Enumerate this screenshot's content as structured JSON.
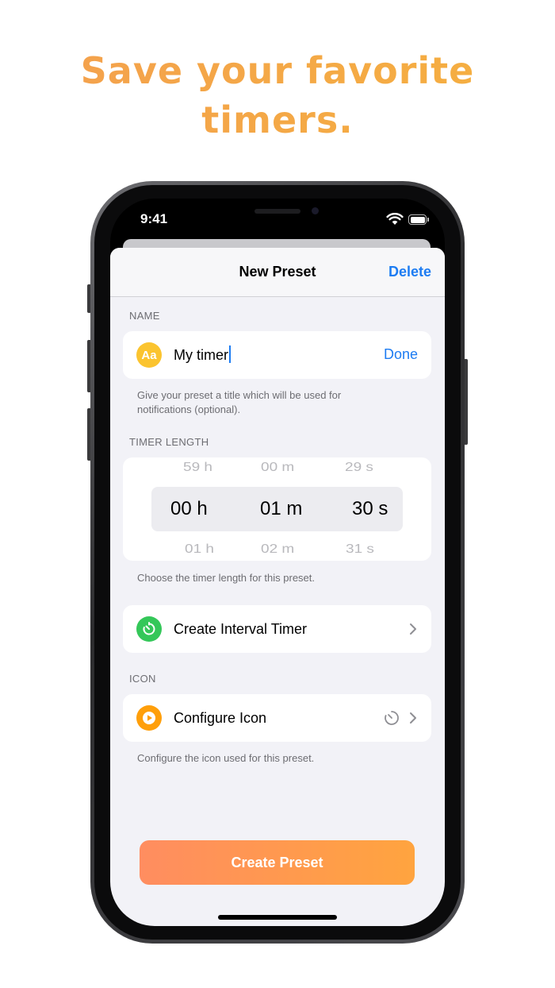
{
  "headline": {
    "line1": "Save your favorite",
    "line2": "timers."
  },
  "status_bar": {
    "time": "9:41",
    "wifi_icon": "wifi-icon",
    "battery_icon": "battery-icon"
  },
  "nav": {
    "title": "New Preset",
    "delete_label": "Delete"
  },
  "name_section": {
    "header": "NAME",
    "icon": "text-aa-icon",
    "icon_text": "Aa",
    "value": "My timer",
    "done_label": "Done",
    "footnote": "Give your preset a title which will be used for notifications (optional)."
  },
  "timer_section": {
    "header": "TIMER LENGTH",
    "picker": {
      "hours": {
        "prev": "59 h",
        "selected": "00 h",
        "next": "01 h"
      },
      "minutes": {
        "prev": "00 m",
        "selected": "01 m",
        "next": "02 m"
      },
      "seconds": {
        "prev": "29 s",
        "selected": "30 s",
        "next": "31 s"
      }
    },
    "footnote": "Choose the timer length for this preset."
  },
  "interval_row": {
    "icon": "stopwatch-icon",
    "label": "Create Interval Timer"
  },
  "icon_section": {
    "header": "ICON",
    "row_icon": "play-icon",
    "label": "Configure Icon",
    "preview_icon": "timer-icon",
    "footnote": "Configure the icon used for this preset."
  },
  "cta": {
    "label": "Create Preset"
  },
  "colors": {
    "accent_blue": "#1d7cf2",
    "headline_orange": "#f4a04e",
    "cta_start": "#ff8d60",
    "cta_end": "#ffa43f",
    "green": "#34c759",
    "orange": "#ff9f0a",
    "yellow": "#fbc42f"
  }
}
